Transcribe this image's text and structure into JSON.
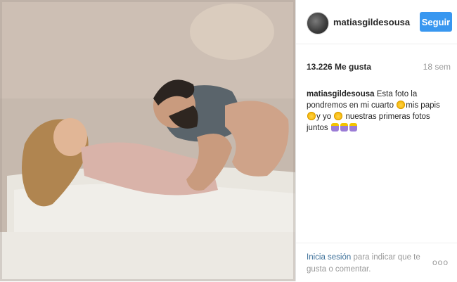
{
  "post": {
    "image_alt": "photo",
    "image_description": "Framed print of a couple lying together on a bed"
  },
  "header": {
    "username": "matiasgildesousa",
    "follow_label": "Seguir"
  },
  "stats": {
    "likes": "13.226 Me gusta",
    "time": "18 sem"
  },
  "caption": {
    "username": "matiasgildesousa",
    "text_part1": "Esta foto la pondremos en mi cuarto",
    "text_part2": "mis papis",
    "text_part3": "y yo",
    "text_part4": "nuestras primeras fotos juntos"
  },
  "footer": {
    "login_label": "Inicia sesión",
    "prompt_text": "para indicar que te gusta o comentar.",
    "more_label": "ooo"
  },
  "colors": {
    "accent": "#3897f0",
    "link": "#3f729b",
    "text": "#262626",
    "muted": "#999999"
  },
  "icons": [
    "avatar",
    "heart-eyes-emoji",
    "kiss-emoji",
    "angel-emoji",
    "family-emoji",
    "more-options-icon"
  ]
}
